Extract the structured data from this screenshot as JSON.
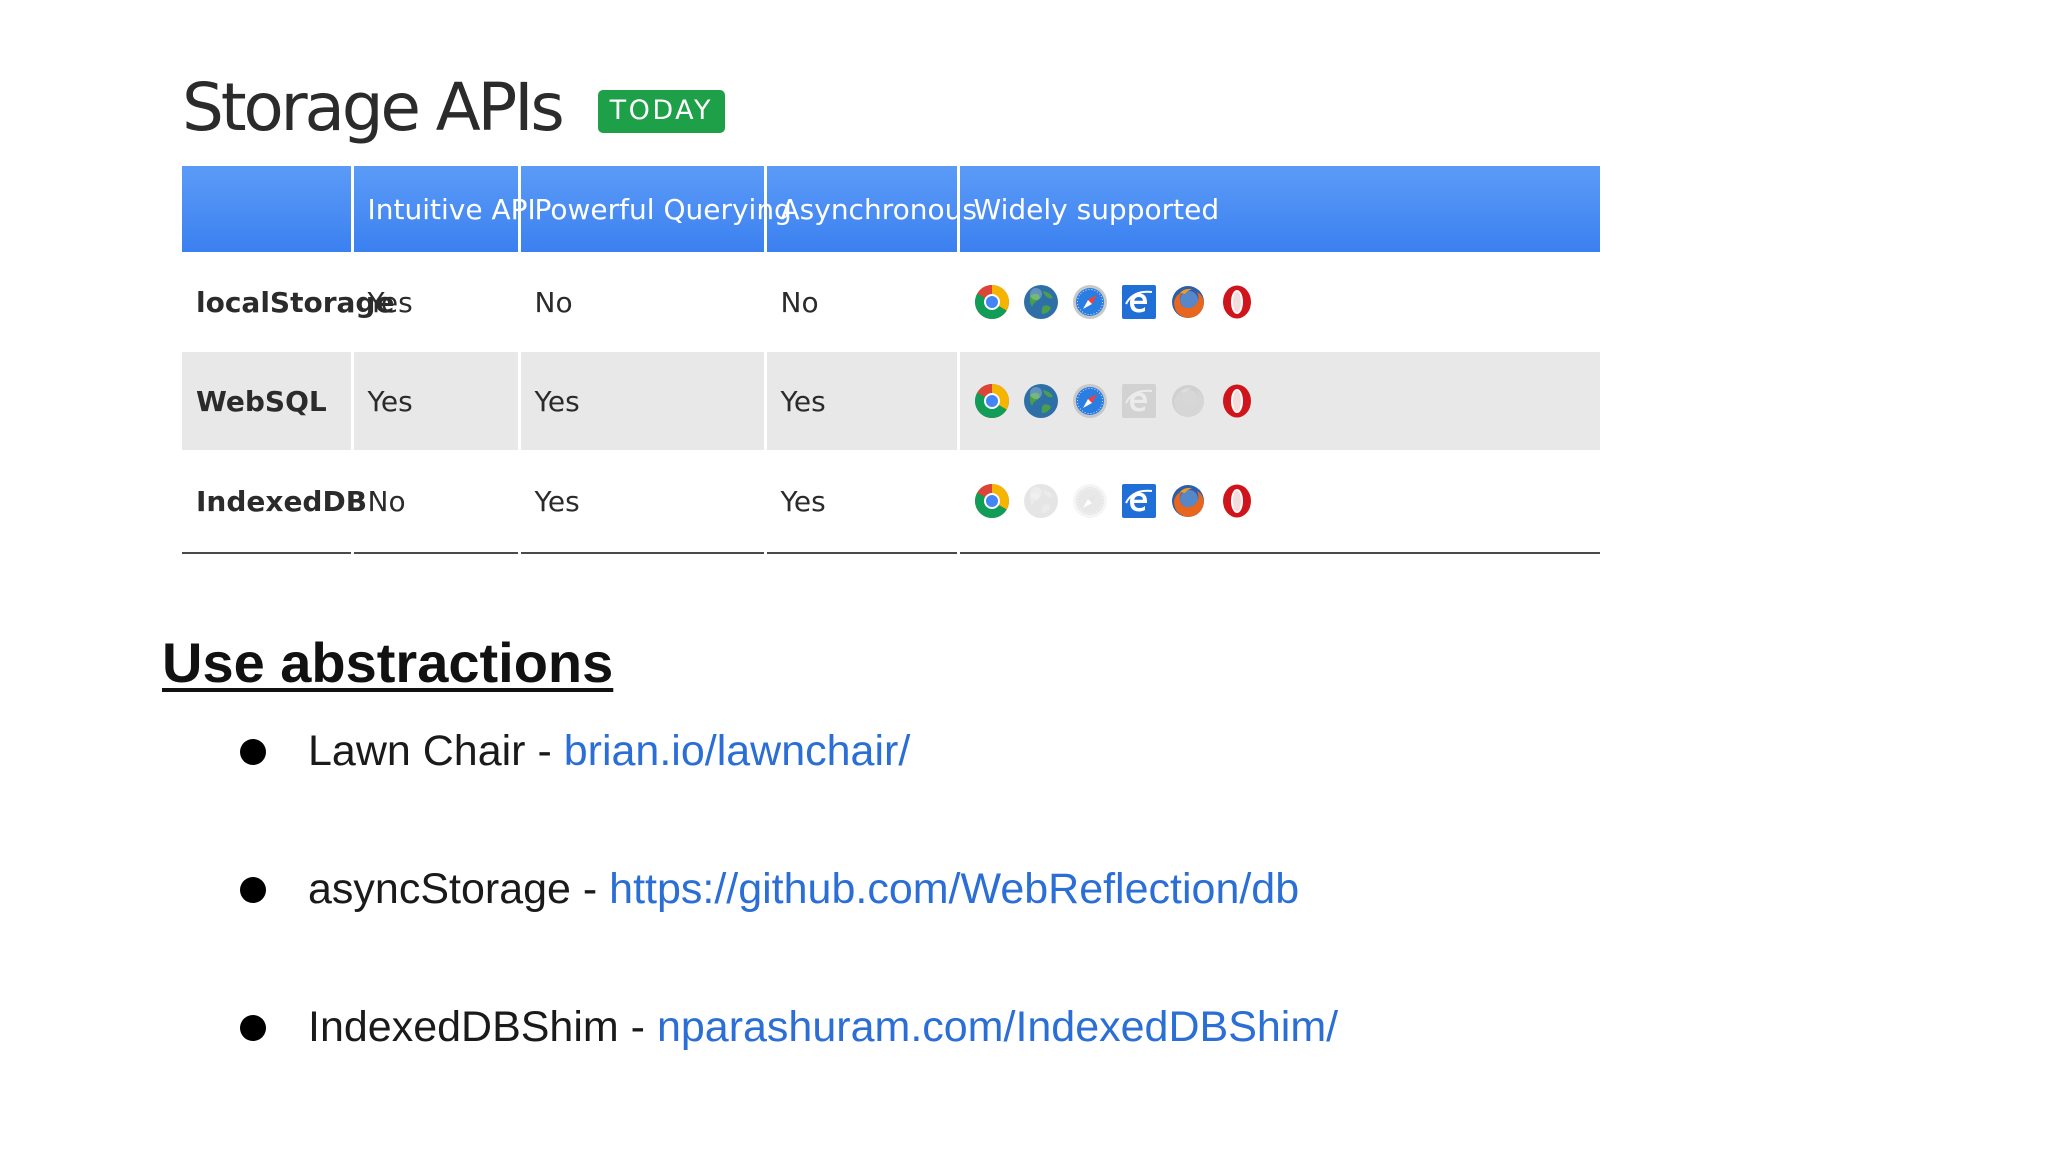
{
  "title": "Storage APIs",
  "badge": "TODAY",
  "table": {
    "headers": [
      "",
      "Intuitive API",
      "Powerful Querying",
      "Asynchronous",
      "Widely supported"
    ],
    "rows": [
      {
        "name": "localStorage",
        "cells": [
          "Yes",
          "No",
          "No"
        ],
        "browsers": [
          "chrome",
          "webkit",
          "safari",
          "ie",
          "firefox",
          "opera"
        ],
        "supported": [
          true,
          true,
          true,
          true,
          true,
          true
        ]
      },
      {
        "name": "WebSQL",
        "cells": [
          "Yes",
          "Yes",
          "Yes"
        ],
        "browsers": [
          "chrome",
          "webkit",
          "safari",
          "ie",
          "firefox",
          "opera"
        ],
        "supported": [
          true,
          true,
          true,
          false,
          false,
          true
        ]
      },
      {
        "name": "IndexedDB",
        "cells": [
          "No",
          "Yes",
          "Yes"
        ],
        "browsers": [
          "chrome",
          "webkit",
          "safari",
          "ie",
          "firefox",
          "opera"
        ],
        "supported": [
          true,
          false,
          false,
          true,
          true,
          true
        ]
      }
    ]
  },
  "section_title": "Use abstractions",
  "links": [
    {
      "label": "Lawn Chair",
      "sep": " - ",
      "url": "brian.io/lawnchair/"
    },
    {
      "label": "asyncStorage",
      "sep": " - ",
      "url": "https://github.com/WebReflection/db"
    },
    {
      "label": "IndexedDBShim",
      "sep": " - ",
      "url": "nparashuram.com/IndexedDBShim/"
    }
  ],
  "colors": {
    "header_blue": "#4a8ef5",
    "badge_green": "#1ea048",
    "link_blue": "#2a6ed6",
    "stripe_gray": "#e8e8e8"
  }
}
